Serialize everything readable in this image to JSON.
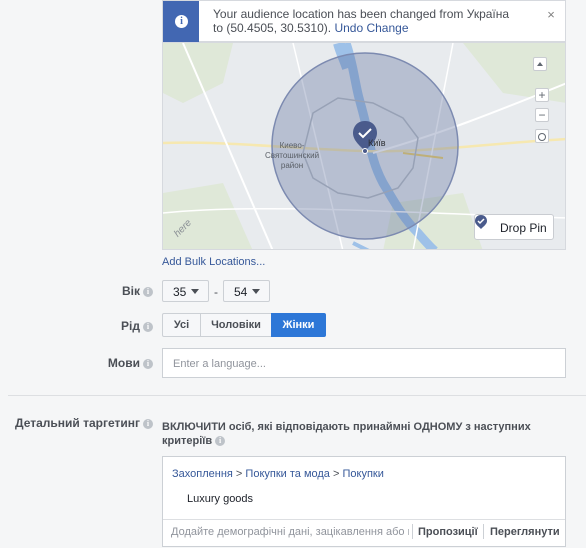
{
  "notice": {
    "icon": "info-icon",
    "text": "Your audience location has been changed from Україна to (50.4505, 30.5310).",
    "undo_label": "Undo Change",
    "close_icon": "close-icon"
  },
  "map": {
    "labels": {
      "district": "Киево-\nСвятошинский\nрайон",
      "city": "Київ",
      "watermark": "here"
    },
    "zoom_in": "+",
    "zoom_out": "−",
    "drop_pin_label": "Drop Pin"
  },
  "bulk_locations_label": "Add Bulk Locations...",
  "age": {
    "label": "Вік",
    "min": "35",
    "max": "54",
    "separator": "-"
  },
  "gender": {
    "label": "Рід",
    "options": [
      "Усі",
      "Чоловіки",
      "Жінки"
    ],
    "selected": "Жінки"
  },
  "languages": {
    "label": "Мови",
    "placeholder": "Enter a language..."
  },
  "detailed_targeting": {
    "label": "Детальний таргетинг",
    "description": "ВКЛЮЧИТИ осіб, які відповідають принаймні ОДНОМУ з наступних критеріїв",
    "breadcrumb": [
      "Захоплення",
      "Покупки та мода",
      "Покупки"
    ],
    "selected_item": "Luxury goods",
    "search_placeholder": "Додайте демографічні дані, зацікавлення або поведінку",
    "suggestions_label": "Пропозиції",
    "browse_label": "Переглянути"
  },
  "colors": {
    "accent": "#4267b2",
    "selected_button": "#2d77d7",
    "link": "#365899"
  }
}
